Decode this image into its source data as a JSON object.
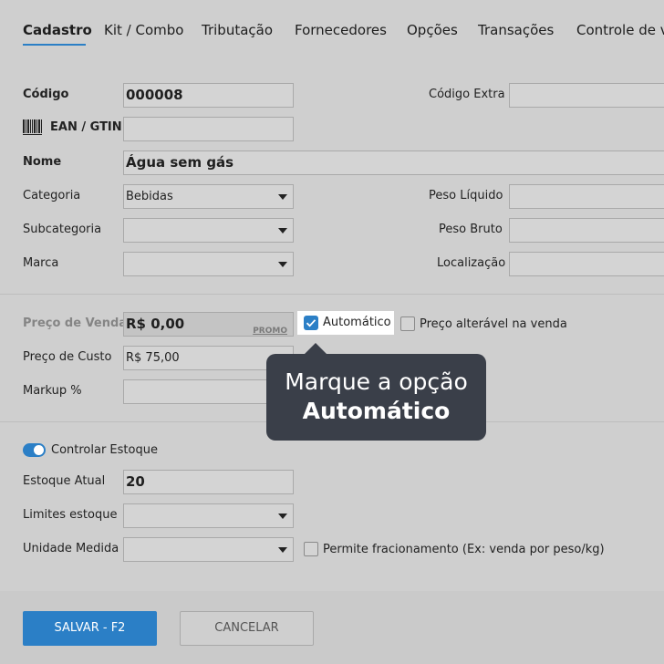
{
  "tabs": [
    {
      "label": "Cadastro"
    },
    {
      "label": "Kit / Combo"
    },
    {
      "label": "Tributação"
    },
    {
      "label": "Fornecedores"
    },
    {
      "label": "Opções"
    },
    {
      "label": "Transações"
    },
    {
      "label": "Controle de v"
    }
  ],
  "form": {
    "codigo": {
      "label": "Código",
      "value": "000008"
    },
    "codigo_extra": {
      "label": "Código Extra",
      "value": ""
    },
    "ean": {
      "label": "EAN / GTIN",
      "value": ""
    },
    "nome": {
      "label": "Nome",
      "value": "Água sem gás"
    },
    "categoria": {
      "label": "Categoria",
      "value": "Bebidas"
    },
    "peso_liquido": {
      "label": "Peso Líquido",
      "value": ""
    },
    "subcategoria": {
      "label": "Subcategoria",
      "value": ""
    },
    "peso_bruto": {
      "label": "Peso Bruto",
      "value": ""
    },
    "marca": {
      "label": "Marca",
      "value": ""
    },
    "localizacao": {
      "label": "Localização",
      "value": ""
    },
    "preco_venda": {
      "label": "Preço de Venda",
      "value": "R$ 0,00",
      "promo": "PROMO"
    },
    "automatico": {
      "label": "Automático",
      "checked": true
    },
    "preco_alteravel": {
      "label": "Preço alterável na venda",
      "checked": false
    },
    "preco_custo": {
      "label": "Preço de Custo",
      "value": "R$ 75,00"
    },
    "markup": {
      "label": "Markup %",
      "value": ""
    },
    "controlar_estoque": {
      "label": "Controlar Estoque",
      "on": true
    },
    "estoque_atual": {
      "label": "Estoque Atual",
      "value": "20"
    },
    "limites_estoque": {
      "label": "Limites estoque",
      "value": ""
    },
    "unidade_medida": {
      "label": "Unidade Medida",
      "value": ""
    },
    "fracionamento": {
      "label": "Permite fracionamento (Ex: venda por peso/kg)",
      "checked": false
    }
  },
  "tooltip": {
    "line1": "Marque a opção",
    "line2": "Automático"
  },
  "footer": {
    "save_label": "SALVAR - F2",
    "cancel_label": "CANCELAR"
  },
  "colors": {
    "accent": "#2b7fc6",
    "tooltip_bg": "#3a3f49",
    "overlay": "#cfcfcf"
  }
}
